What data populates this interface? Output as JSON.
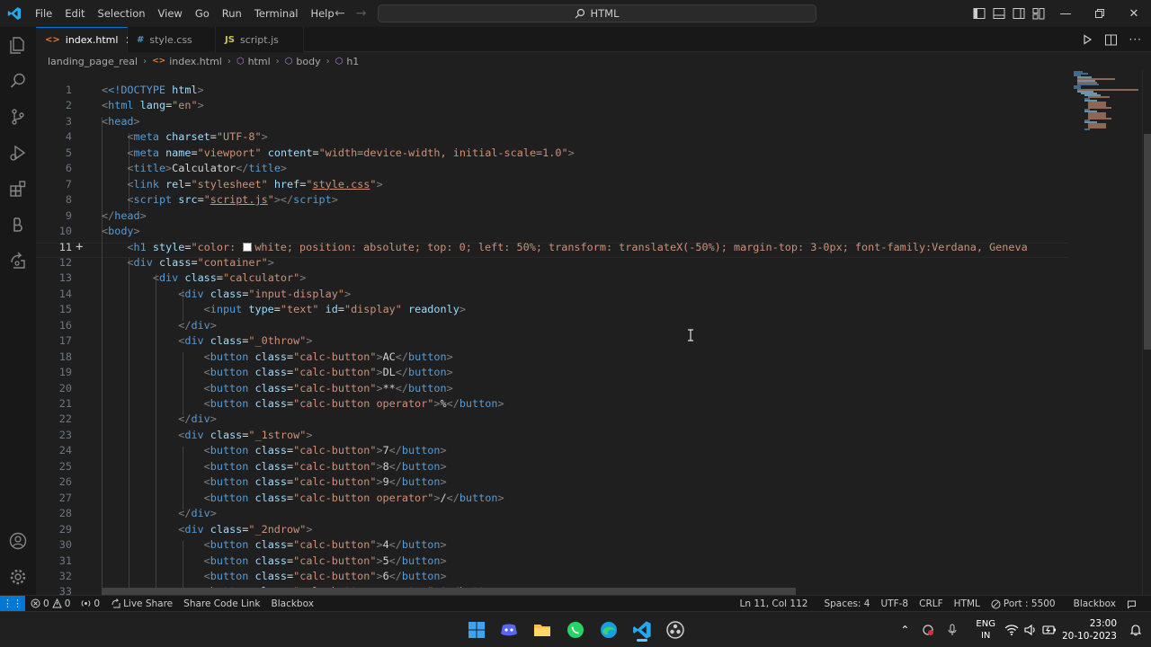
{
  "menu": [
    "File",
    "Edit",
    "Selection",
    "View",
    "Go",
    "Run",
    "Terminal",
    "Help"
  ],
  "command_center": "HTML",
  "tabs": [
    {
      "icon": "<>",
      "label": "index.html",
      "active": true
    },
    {
      "icon": "#",
      "label": "style.css",
      "active": false
    },
    {
      "icon": "JS",
      "label": "script.js",
      "active": false
    }
  ],
  "breadcrumb": [
    "landing_page_real",
    "index.html",
    "html",
    "body",
    "h1"
  ],
  "active_line": 11,
  "lines": [
    {
      "n": "1"
    },
    {
      "n": "2"
    },
    {
      "n": "3"
    },
    {
      "n": "4"
    },
    {
      "n": "5"
    },
    {
      "n": "6"
    },
    {
      "n": "7"
    },
    {
      "n": "8"
    },
    {
      "n": "9"
    },
    {
      "n": "10"
    },
    {
      "n": "11"
    },
    {
      "n": "12"
    },
    {
      "n": "13"
    },
    {
      "n": "14"
    },
    {
      "n": "15"
    },
    {
      "n": "16"
    },
    {
      "n": "17"
    },
    {
      "n": "18"
    },
    {
      "n": "19"
    },
    {
      "n": "20"
    },
    {
      "n": "21"
    },
    {
      "n": "22"
    },
    {
      "n": "23"
    },
    {
      "n": "24"
    },
    {
      "n": "25"
    },
    {
      "n": "26"
    },
    {
      "n": "27"
    },
    {
      "n": "28"
    },
    {
      "n": "29"
    },
    {
      "n": "30"
    },
    {
      "n": "31"
    },
    {
      "n": "32"
    },
    {
      "n": "33"
    }
  ],
  "code": {
    "l1_doctype": "<!DOCTYPE",
    "l1_html": " html",
    "l2_lang": "\"en\"",
    "l4_charset": "\"UTF-8\"",
    "l5_name": "\"viewport\"",
    "l5_content": "\"width=device-width, initial-scale=1.0\"",
    "l6_title_text": "Calculator",
    "l7_rel": "\"stylesheet\"",
    "l7_href": "style.css",
    "l8_src": "script.js",
    "l11_style_a": "\"color: ",
    "l11_style_b": "white; position: absolute; top: 0; left: 50%; transform: translateX(-50%); margin-top: 3-0px; font-family:Verdana, Geneva",
    "l12_class": "\"container\"",
    "l13_class": "\"calculator\"",
    "l14_class": "\"input-display\"",
    "l15_type": "\"text\"",
    "l15_id": "\"display\"",
    "l15_readonly": " readonly",
    "l17_class": "\"_0throw\"",
    "l23_class": "\"_1strow\"",
    "l29_class": "\"_2ndrow\"",
    "calc_button": "\"calc-button\"",
    "calc_button_op": "\"calc-button operator\"",
    "btn_ac": "AC",
    "btn_dl": "DL",
    "btn_pow": "**",
    "btn_mod": "%",
    "btn_7": "7",
    "btn_8": "8",
    "btn_9": "9",
    "btn_div": "/",
    "btn_4": "4",
    "btn_5": "5",
    "btn_6": "6",
    "btn_mul": "*"
  },
  "status": {
    "errors": "0",
    "warnings": "0",
    "ports": "0",
    "live_share": "Live Share",
    "share_code_link": "Share Code Link",
    "blackbox": "Blackbox",
    "position": "Ln 11, Col 112",
    "spaces": "Spaces: 4",
    "encoding": "UTF-8",
    "eol": "CRLF",
    "language": "HTML",
    "port": "Port : 5500",
    "blackbox_right": "Blackbox"
  },
  "taskbar": {
    "lang_top": "ENG",
    "lang_bottom": "IN",
    "time": "23:00",
    "date": "20-10-2023"
  },
  "colors": {
    "accent": "#0078d4",
    "tag": "#569cd6",
    "attr": "#9cdcfe",
    "string": "#ce9178"
  }
}
